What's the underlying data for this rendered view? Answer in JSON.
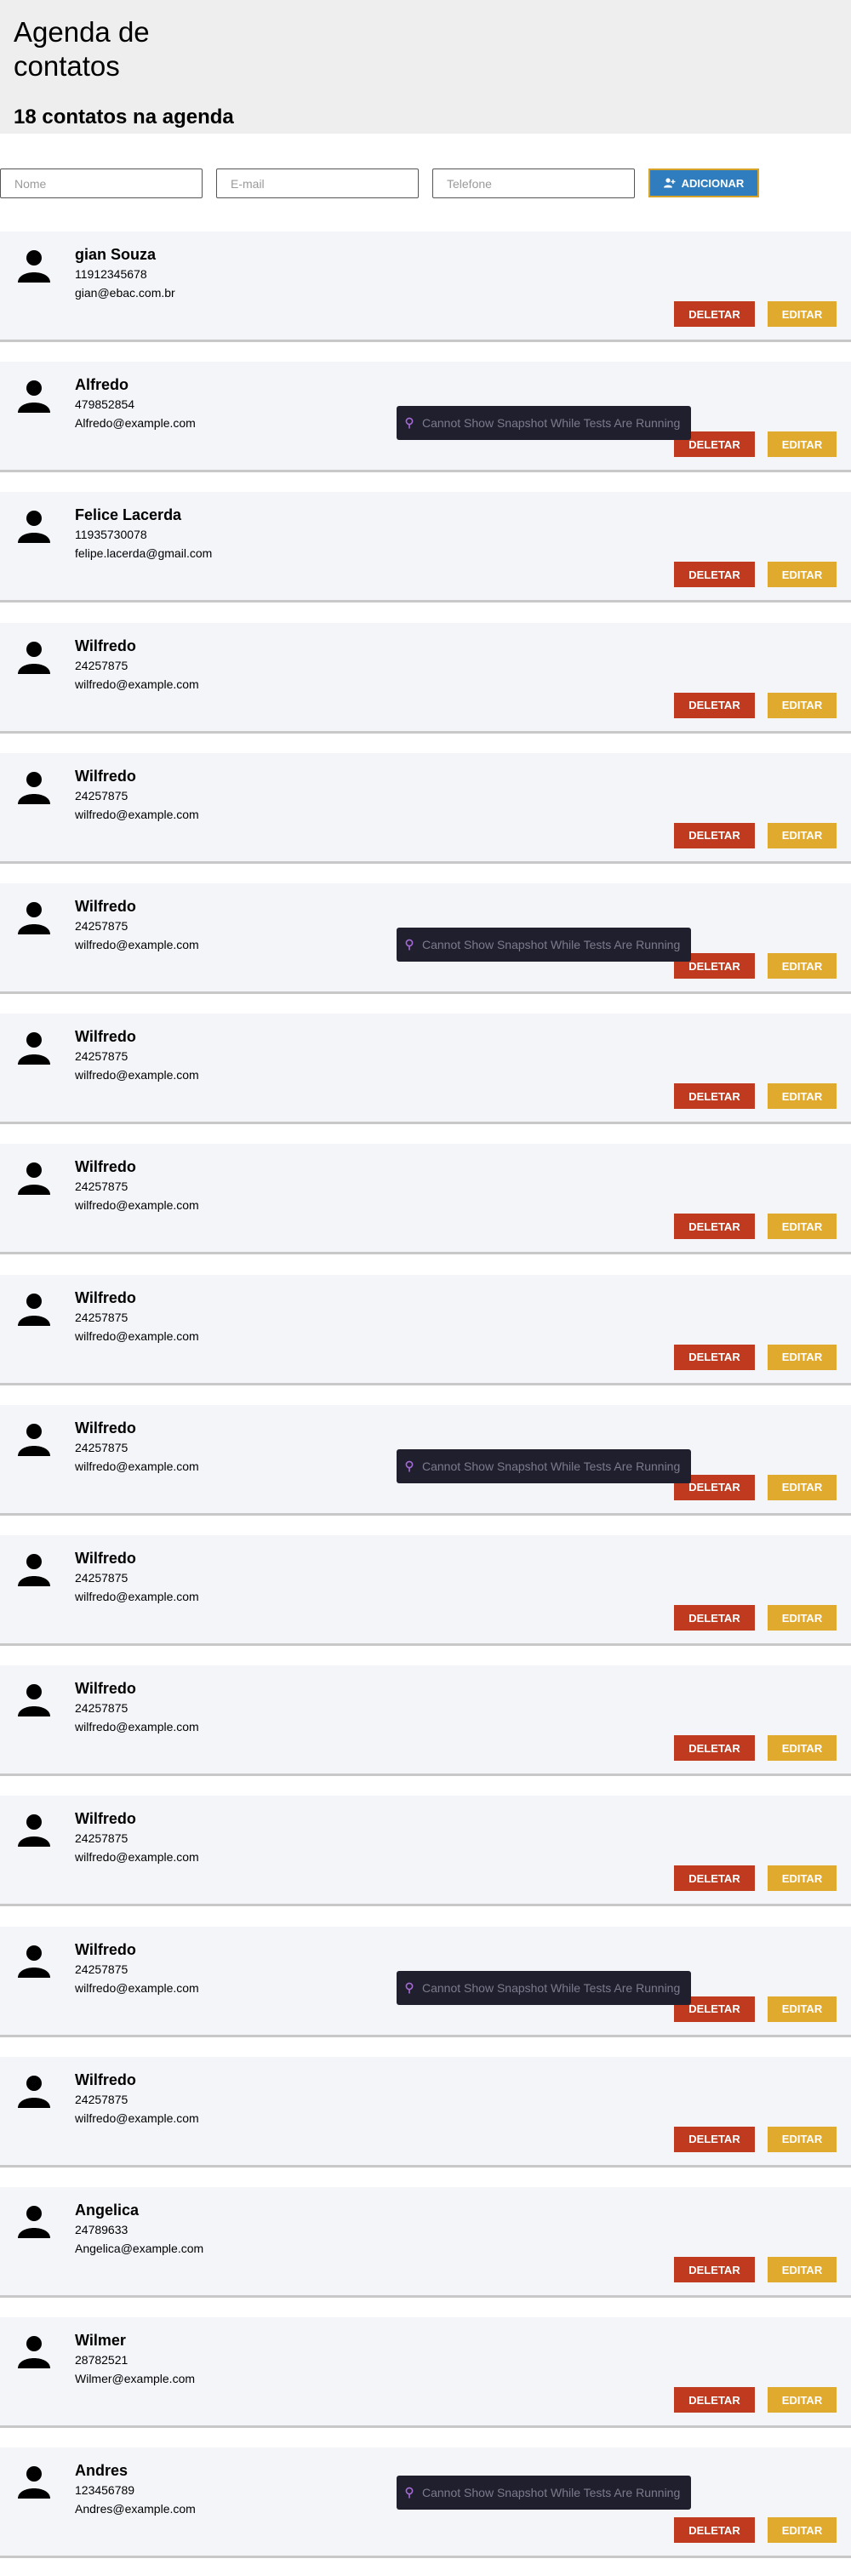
{
  "header": {
    "title": "Agenda de contatos",
    "count_text": "18 contatos na agenda"
  },
  "form": {
    "name_placeholder": "Nome",
    "email_placeholder": "E-mail",
    "phone_placeholder": "Telefone",
    "add_label": "ADICIONAR",
    "add_icon": "add-user-icon"
  },
  "contacts": [
    {
      "name": "gian Souza",
      "phone": "11912345678",
      "email": "gian@ebac.com.br"
    },
    {
      "name": "Alfredo",
      "phone": "479852854",
      "email": "Alfredo@example.com"
    },
    {
      "name": "Felice Lacerda",
      "phone": "11935730078",
      "email": "felipe.lacerda@gmail.com"
    },
    {
      "name": "Wilfredo",
      "phone": "24257875",
      "email": "wilfredo@example.com"
    },
    {
      "name": "Wilfredo",
      "phone": "24257875",
      "email": "wilfredo@example.com"
    },
    {
      "name": "Wilfredo",
      "phone": "24257875",
      "email": "wilfredo@example.com"
    },
    {
      "name": "Wilfredo",
      "phone": "24257875",
      "email": "wilfredo@example.com"
    },
    {
      "name": "Wilfredo",
      "phone": "24257875",
      "email": "wilfredo@example.com"
    },
    {
      "name": "Wilfredo",
      "phone": "24257875",
      "email": "wilfredo@example.com"
    },
    {
      "name": "Wilfredo",
      "phone": "24257875",
      "email": "wilfredo@example.com"
    },
    {
      "name": "Wilfredo",
      "phone": "24257875",
      "email": "wilfredo@example.com"
    },
    {
      "name": "Wilfredo",
      "phone": "24257875",
      "email": "wilfredo@example.com"
    },
    {
      "name": "Wilfredo",
      "phone": "24257875",
      "email": "wilfredo@example.com"
    },
    {
      "name": "Wilfredo",
      "phone": "24257875",
      "email": "wilfredo@example.com"
    },
    {
      "name": "Wilfredo",
      "phone": "24257875",
      "email": "wilfredo@example.com"
    },
    {
      "name": "Angelica",
      "phone": "24789633",
      "email": "Angelica@example.com"
    },
    {
      "name": "Wilmer",
      "phone": "28782521",
      "email": "Wilmer@example.com"
    },
    {
      "name": "Andres",
      "phone": "123456789",
      "email": "Andres@example.com"
    }
  ],
  "contact_actions": {
    "delete_label": "DELETAR",
    "edit_label": "EDITAR",
    "avatar_icon": "user-icon"
  },
  "snapshot_notice": {
    "text": "Cannot Show Snapshot While Tests Are Running",
    "icon": "pin-icon",
    "count": 5
  },
  "colors": {
    "header_bg": "#eeeeee",
    "card_bg": "#f4f5f9",
    "add_button": "#2f7dbf",
    "add_button_border": "#d6a227",
    "delete_button": "#c03a1f",
    "edit_button": "#e0aa2e",
    "notice_bg": "#1f1f2e"
  }
}
